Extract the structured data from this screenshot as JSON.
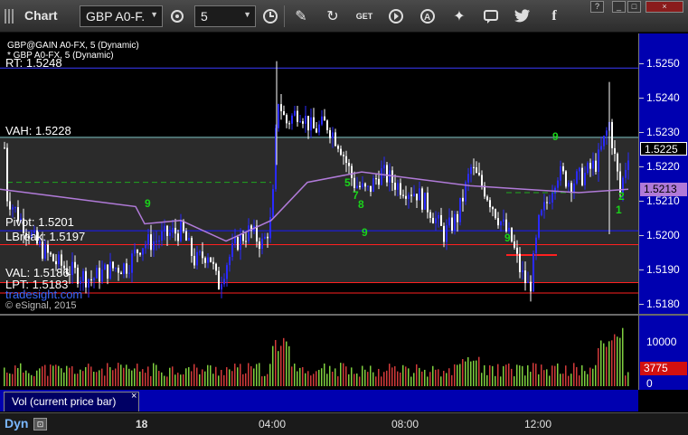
{
  "toolbar": {
    "app_title": "Chart",
    "symbol": "GBP A0-F.",
    "interval": "5"
  },
  "window_buttons": [
    "?",
    "_",
    "□",
    "×"
  ],
  "chart": {
    "symbol_line_1": "GBP@GAIN A0-FX, 5 (Dynamic)",
    "symbol_line_2": "* GBP A0-FX, 5 (Dynamic)",
    "copyright": "© eSignal, 2015",
    "watermark": "tradesight.com",
    "levels": [
      {
        "label": "RT: 1.5248",
        "price": 1.5248,
        "color": "#3a3aff"
      },
      {
        "label": "VAH: 1.5228",
        "price": 1.5228,
        "color": "#7fc7c7"
      },
      {
        "label": "Pivot: 1.5201",
        "price": 1.5201,
        "color": "#1a1aff"
      },
      {
        "label": "LBreak: 1.5197",
        "price": 1.5197,
        "color": "#ff2020"
      },
      {
        "label": "VAL: 1.5186",
        "price": 1.5186,
        "color": "#ff2020"
      },
      {
        "label": "LPT: 1.5183",
        "price": 1.5183,
        "color": "#ff2020"
      }
    ],
    "current_price": "1.5225",
    "ma_price": "1.5213"
  },
  "price_axis": {
    "ticks": [
      "1.5250",
      "1.5240",
      "1.5230",
      "1.5220",
      "1.5210",
      "1.5200",
      "1.5190",
      "1.5180"
    ]
  },
  "volume": {
    "title": "Vol (current price bar)",
    "close": "×",
    "ticks": [
      "10000",
      "0"
    ],
    "current": "3775"
  },
  "time_axis": {
    "mode": "Dyn",
    "labels": [
      "18",
      "04:00",
      "08:00",
      "12:00"
    ]
  },
  "td_counts": [
    "9",
    "5",
    "7",
    "8",
    "9",
    "9",
    "9",
    "2",
    "1"
  ],
  "chart_data": {
    "type": "candlestick",
    "title": "GBP@GAIN A0-FX, 5 (Dynamic)",
    "ylim": [
      1.5177,
      1.5258
    ],
    "x_ticks": [
      "18",
      "04:00",
      "08:00",
      "12:00"
    ],
    "levels": {
      "RT": 1.5248,
      "VAH": 1.5228,
      "Pivot": 1.5201,
      "LBreak": 1.5197,
      "VAL": 1.5186,
      "LPT": 1.5183
    },
    "last": 1.5225,
    "ma_last": 1.5213,
    "volume_last": 3775,
    "volume_ylim": [
      0,
      15000
    ]
  },
  "colors": {
    "up": "#2a2aff",
    "down": "#ffffff",
    "ma": "#b07ad8",
    "panel_bg": "#0000b0",
    "vol_up": "#7fcf3f",
    "vol_down": "#d23a3a"
  }
}
